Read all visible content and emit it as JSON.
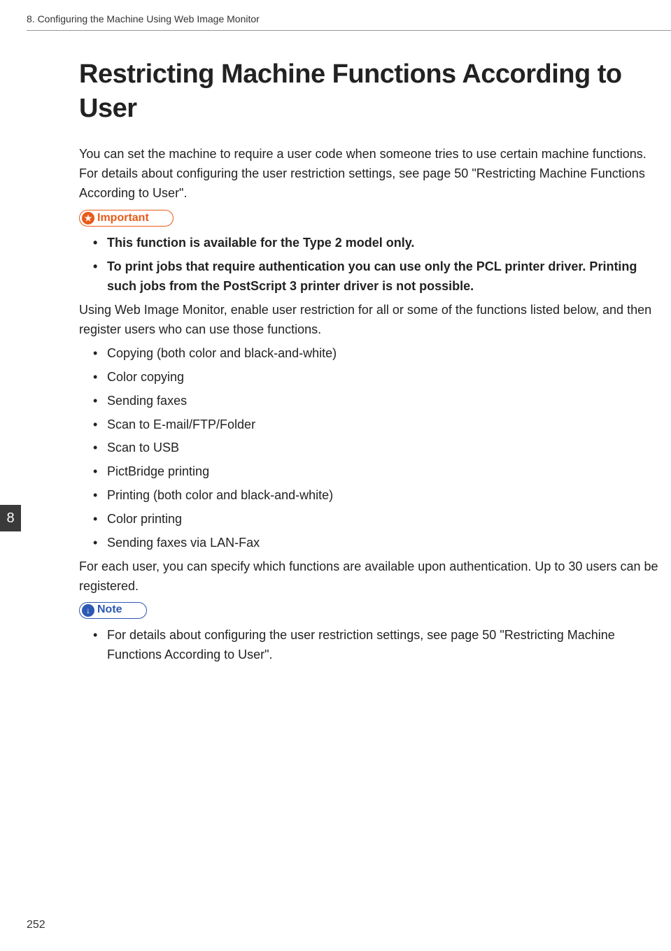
{
  "header": "8. Configuring the Machine Using Web Image Monitor",
  "title": "Restricting Machine Functions According to User",
  "intro": "You can set the machine to require a user code when someone tries to use certain machine functions. For details about configuring the user restriction settings, see page 50 \"Restricting Machine Functions According to User\".",
  "important_label": "Important",
  "important_items": [
    "This function is available for the Type 2 model only.",
    "To print jobs that require authentication you can use only the PCL printer driver. Printing such jobs from the PostScript 3 printer driver is not possible."
  ],
  "body1": "Using Web Image Monitor, enable user restriction for all or some of the functions listed below, and then register users who can use those functions.",
  "function_items": [
    "Copying (both color and black-and-white)",
    "Color copying",
    "Sending faxes",
    "Scan to E-mail/FTP/Folder",
    "Scan to USB",
    "PictBridge printing",
    "Printing (both color and black-and-white)",
    "Color printing",
    "Sending faxes via LAN-Fax"
  ],
  "body2": "For each user, you can specify which functions are available upon authentication. Up to 30 users can be registered.",
  "note_label": "Note",
  "note_items": [
    "For details about configuring the user restriction settings, see page 50 \"Restricting Machine Functions According to User\"."
  ],
  "side_tab": "8",
  "page_number": "252"
}
